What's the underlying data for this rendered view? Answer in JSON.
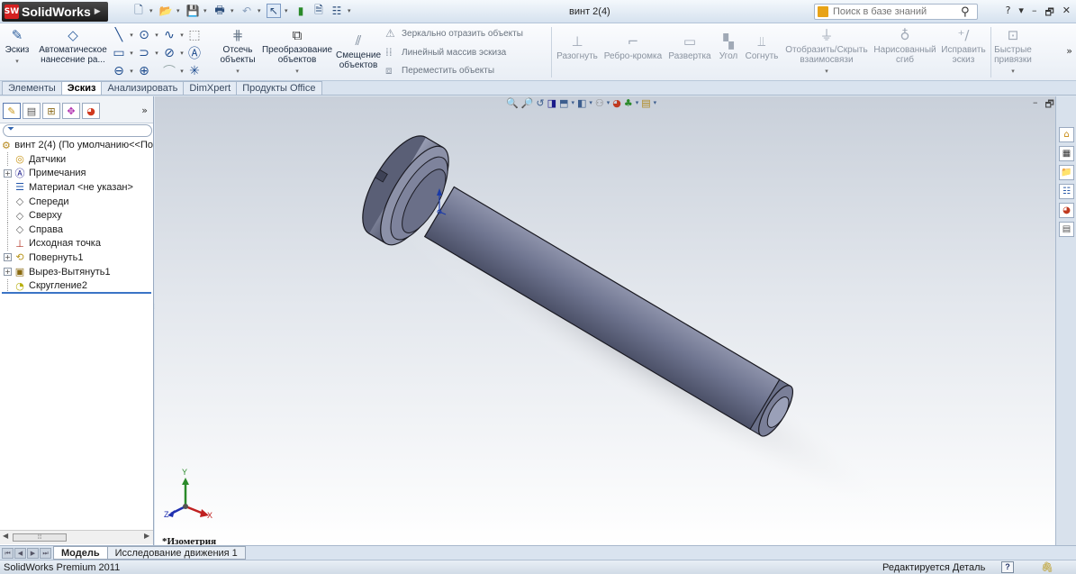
{
  "app": {
    "logo_mark": "SW",
    "logo_text": "SolidWorks",
    "document_title": "винт 2(4)",
    "search_placeholder": "Поиск в базе знаний",
    "help": "?",
    "window_controls": [
      "▾",
      "–",
      "🗗",
      "✕"
    ]
  },
  "command_manager": {
    "sketch_label": "Эскиз",
    "smart_dim_label": "Автоматическое нанесение ра...",
    "trim_label": "Отсечь объекты",
    "convert_label": "Преобразование объектов",
    "offset_label": "Смещение объектов",
    "mirror_label": "Зеркально отразить объекты",
    "linear_pattern_label": "Линейный массив эскиза",
    "move_label": "Переместить объекты",
    "unfold_label": "Разогнуть",
    "edge_flange_label": "Ребро-кромка",
    "flatten_label": "Развертка",
    "corner_label": "Угол",
    "fold_label": "Согнуть",
    "display_relations_label": "Отобразить/Скрыть взаимосвязи",
    "sketched_bend_label": "Нарисованный сгиб",
    "repair_sketch_label": "Исправить эскиз",
    "quick_snaps_label": "Быстрые привязки",
    "more": "»"
  },
  "tabs": [
    {
      "label": "Элементы",
      "active": false
    },
    {
      "label": "Эскиз",
      "active": true
    },
    {
      "label": "Анализировать",
      "active": false
    },
    {
      "label": "DimXpert",
      "active": false
    },
    {
      "label": "Продукты Office",
      "active": false
    }
  ],
  "feature_tree": {
    "root": "винт 2(4)  (По умолчанию<<По",
    "more": "»",
    "items": [
      {
        "label": "Датчики",
        "expandable": false,
        "icon": "sensor-icon"
      },
      {
        "label": "Примечания",
        "expandable": true,
        "icon": "annotations-icon"
      },
      {
        "label": "Материал <не указан>",
        "expandable": false,
        "icon": "material-icon"
      },
      {
        "label": "Спереди",
        "expandable": false,
        "icon": "plane-icon"
      },
      {
        "label": "Сверху",
        "expandable": false,
        "icon": "plane-icon"
      },
      {
        "label": "Справа",
        "expandable": false,
        "icon": "plane-icon"
      },
      {
        "label": "Исходная точка",
        "expandable": false,
        "icon": "origin-icon"
      },
      {
        "label": "Повернуть1",
        "expandable": true,
        "icon": "revolve-icon"
      },
      {
        "label": "Вырез-Вытянуть1",
        "expandable": true,
        "icon": "cut-extrude-icon"
      },
      {
        "label": "Скругление2",
        "expandable": false,
        "icon": "fillet-icon"
      }
    ]
  },
  "viewport": {
    "view_label": "*Изометрия",
    "triad": {
      "x": "X",
      "y": "Y",
      "z": "Z"
    }
  },
  "bottom_tabs": [
    {
      "label": "Модель",
      "active": true
    },
    {
      "label": "Исследование движения 1",
      "active": false
    }
  ],
  "status": {
    "product": "SolidWorks Premium 2011",
    "mode": "Редактируется Деталь",
    "help": "?"
  }
}
